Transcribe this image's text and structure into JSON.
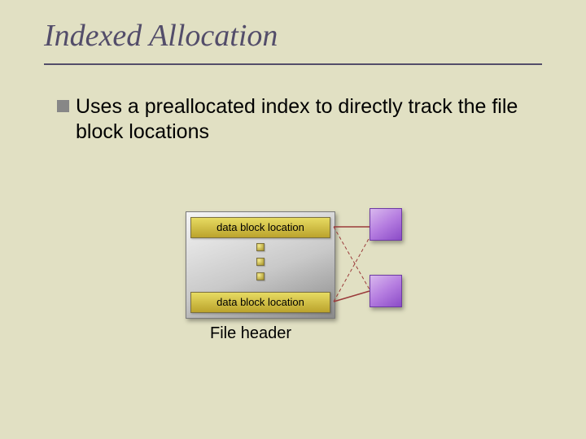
{
  "title": "Indexed Allocation",
  "bullet_text": "Uses a preallocated index to directly track the file block locations",
  "diagram": {
    "index_cell_top": "data block location",
    "index_cell_bot": "data block location",
    "file_header_label": "File header"
  }
}
